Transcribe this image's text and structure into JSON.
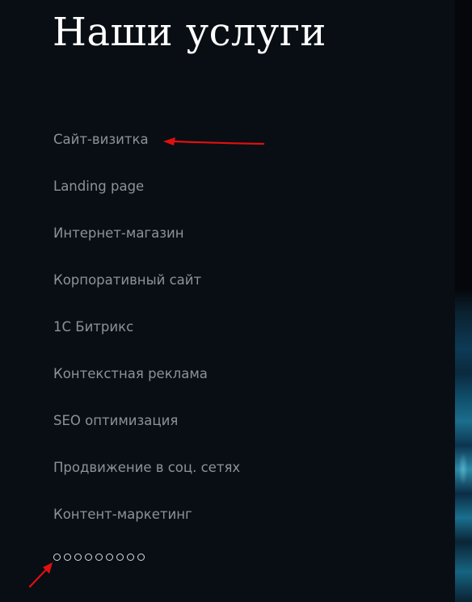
{
  "header": {
    "title": "Наши услуги"
  },
  "services": [
    {
      "label": "Сайт-визитка"
    },
    {
      "label": "Landing page"
    },
    {
      "label": "Интернет-магазин"
    },
    {
      "label": "Корпоративный сайт"
    },
    {
      "label": "1С Битрикс"
    },
    {
      "label": "Контекстная реклама"
    },
    {
      "label": "SEO оптимизация"
    },
    {
      "label": "Продвижение в соц. сетях"
    },
    {
      "label": "Контент-маркетинг"
    }
  ],
  "pagination": {
    "dot_count": 9
  },
  "colors": {
    "background": "#090e14",
    "title": "#ffffff",
    "link": "#8d9298",
    "annotation_arrow": "#e01010"
  }
}
